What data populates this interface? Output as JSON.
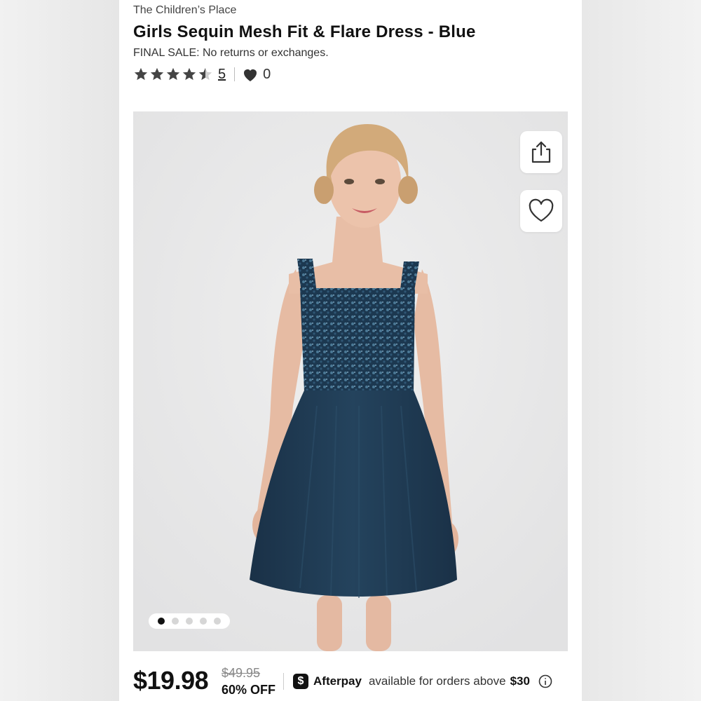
{
  "product": {
    "brand": "The Children’s Place",
    "title": "Girls Sequin Mesh Fit & Flare Dress - Blue",
    "final_sale": "FINAL SALE: No returns or exchanges.",
    "rating_value": 4.5,
    "rating_max": 5,
    "review_count": "5",
    "favorites_count": "0"
  },
  "gallery": {
    "dot_count": 5,
    "active_dot": 1
  },
  "pricing": {
    "price": "$19.98",
    "original_price": "$49.95",
    "discount": "60% OFF",
    "afterpay_label": "Afterpay",
    "afterpay_text": "available for orders above",
    "afterpay_amount": "$30"
  },
  "icons": {
    "share": "share-icon",
    "wishlist": "heart-outline-icon",
    "favorites": "heart-filled-icon",
    "info": "info-icon",
    "afterpay": "afterpay-dollar-icon"
  },
  "colors": {
    "dress": "#1e3a52",
    "sequin_highlight": "#3f6a86",
    "image_bg": "#e8e8e9",
    "text_primary": "#111111"
  }
}
